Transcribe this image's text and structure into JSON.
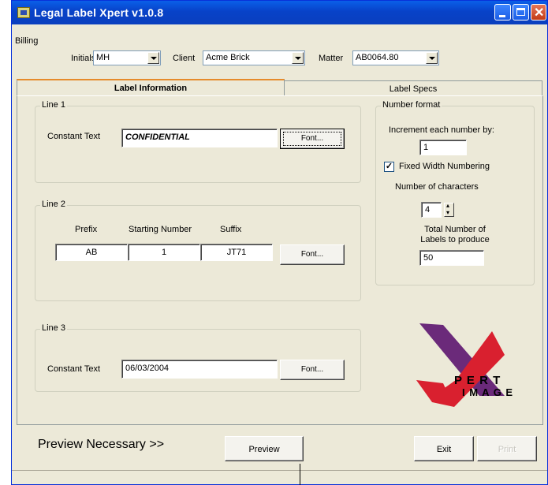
{
  "window": {
    "title": "Legal Label Xpert v1.0.8"
  },
  "menu": {
    "billing": "Billing"
  },
  "header": {
    "initials_label": "Initials",
    "initials_value": "MH",
    "client_label": "Client",
    "client_value": "Acme Brick",
    "matter_label": "Matter",
    "matter_value": "AB0064.80"
  },
  "tabs": [
    {
      "label": "Label Information",
      "active": true
    },
    {
      "label": "Label Specs",
      "active": false
    }
  ],
  "line1": {
    "group_label": "Line 1",
    "constant_text_label": "Constant Text",
    "constant_text_value": "CONFIDENTIAL",
    "font_button": "Font..."
  },
  "line2": {
    "group_label": "Line 2",
    "prefix_label": "Prefix",
    "starting_number_label": "Starting Number",
    "suffix_label": "Suffix",
    "prefix_value": "AB",
    "starting_number_value": "1",
    "suffix_value": "JT71",
    "font_button": "Font..."
  },
  "line3": {
    "group_label": "Line 3",
    "constant_text_label": "Constant Text",
    "constant_text_value": "06/03/2004",
    "font_button": "Font..."
  },
  "number_format": {
    "group_label": "Number format",
    "increment_label": "Increment each number by:",
    "increment_value": "1",
    "fixed_width_label": "Fixed Width Numbering",
    "fixed_width_checked": true,
    "num_chars_label": "Number of characters",
    "num_chars_value": "4",
    "total_label_line1": "Total Number of",
    "total_label_line2": "Labels to produce",
    "total_value": "50"
  },
  "logo": {
    "text_top": "P E R T",
    "text_bottom": "I M A G E",
    "letter_x": "X",
    "colors": {
      "purple": "#6b2a7a",
      "red": "#d9202f"
    }
  },
  "footer": {
    "preview_necessary": "Preview Necessary >>",
    "preview_button": "Preview",
    "exit_button": "Exit",
    "print_button": "Print"
  },
  "colors": {
    "titlebar": "#0842c8",
    "window_bg": "#ece9d8"
  }
}
